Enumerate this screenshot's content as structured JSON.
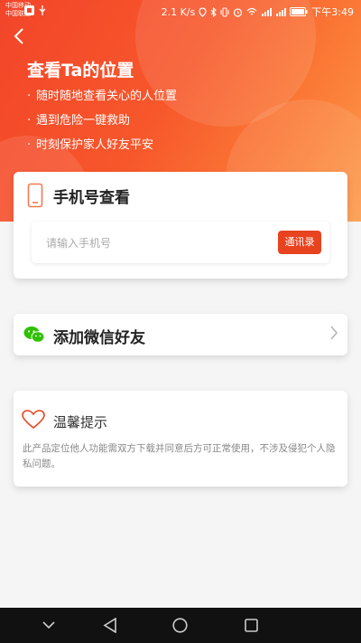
{
  "status_bar": {
    "carrier_1": "中国移动",
    "carrier_2": "中国联通",
    "speed": "2.1 K/s",
    "time": "下午3:49"
  },
  "header": {
    "title": "查看Ta的位置",
    "bullets": [
      "随时随地查看关心的人位置",
      "遇到危险一键救助",
      "时刻保护家人好友平安"
    ]
  },
  "phone_lookup": {
    "label": "手机号查看",
    "input_placeholder": "请输入手机号",
    "input_value": "",
    "contacts_button": "通讯录"
  },
  "wechat": {
    "label": "添加微信好友"
  },
  "tip": {
    "label": "温馨提示",
    "text": "此产品定位他人功能需双方下载并同意后方可正常使用，不涉及侵犯个人隐私问题。"
  },
  "icons": {
    "back": "chevron-left-icon",
    "phone": "phone-icon",
    "wechat": "wechat-icon",
    "arrow": "chevron-right-icon",
    "heart": "heart-icon"
  },
  "colors": {
    "accent": "#e8431f",
    "header_start": "#f2452a",
    "header_end": "#fc9a4a",
    "wechat_green": "#2dc100"
  }
}
